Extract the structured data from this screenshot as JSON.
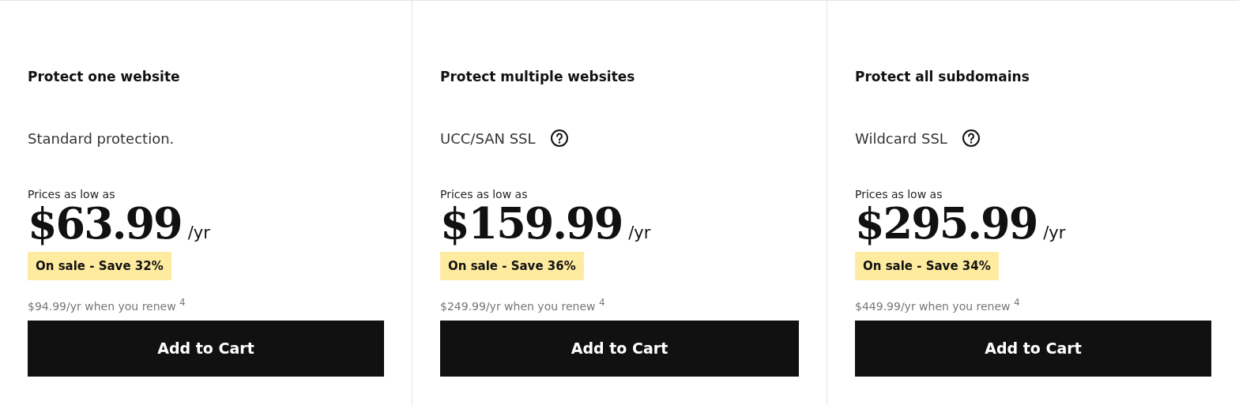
{
  "plans": [
    {
      "title": "Protect one website",
      "subtitle": "Standard protection.",
      "help": false,
      "price_label": "Prices as low as",
      "price": "$63.99",
      "period": "/yr",
      "sale": "On sale - Save 32%",
      "renewal": "$94.99/yr when you renew $^{4}$",
      "button": "Add to Cart"
    },
    {
      "title": "Protect multiple websites",
      "subtitle": "UCC/SAN SSL",
      "help": true,
      "price_label": "Prices as low as",
      "price": "$159.99",
      "period": "/yr",
      "sale": "On sale - Save 36%",
      "renewal": "$249.99/yr when you renew $^{4}$",
      "button": "Add to Cart"
    },
    {
      "title": "Protect all subdomains",
      "subtitle": "Wildcard SSL",
      "help": true,
      "price_label": "Prices as low as",
      "price": "$295.99",
      "period": "/yr",
      "sale": "On sale - Save 34%",
      "renewal": "$449.99/yr when you renew $^{4}$",
      "button": "Add to Cart"
    }
  ]
}
